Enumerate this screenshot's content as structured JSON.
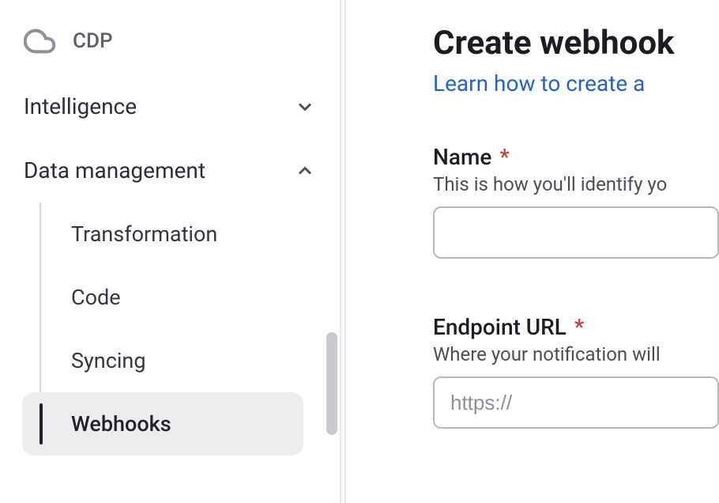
{
  "sidebar": {
    "top_item": {
      "label": "CDP"
    },
    "sections": {
      "intelligence": {
        "label": "Intelligence"
      },
      "data_management": {
        "label": "Data management",
        "items": [
          {
            "label": "Transformation"
          },
          {
            "label": "Code"
          },
          {
            "label": "Syncing"
          },
          {
            "label": "Webhooks"
          }
        ]
      }
    }
  },
  "main": {
    "title": "Create webhook",
    "help_link": "Learn how to create a",
    "fields": {
      "name": {
        "label": "Name",
        "hint": "This is how you'll identify yo"
      },
      "endpoint": {
        "label": "Endpoint URL",
        "hint": "Where your notification will",
        "placeholder": "https://"
      }
    }
  }
}
